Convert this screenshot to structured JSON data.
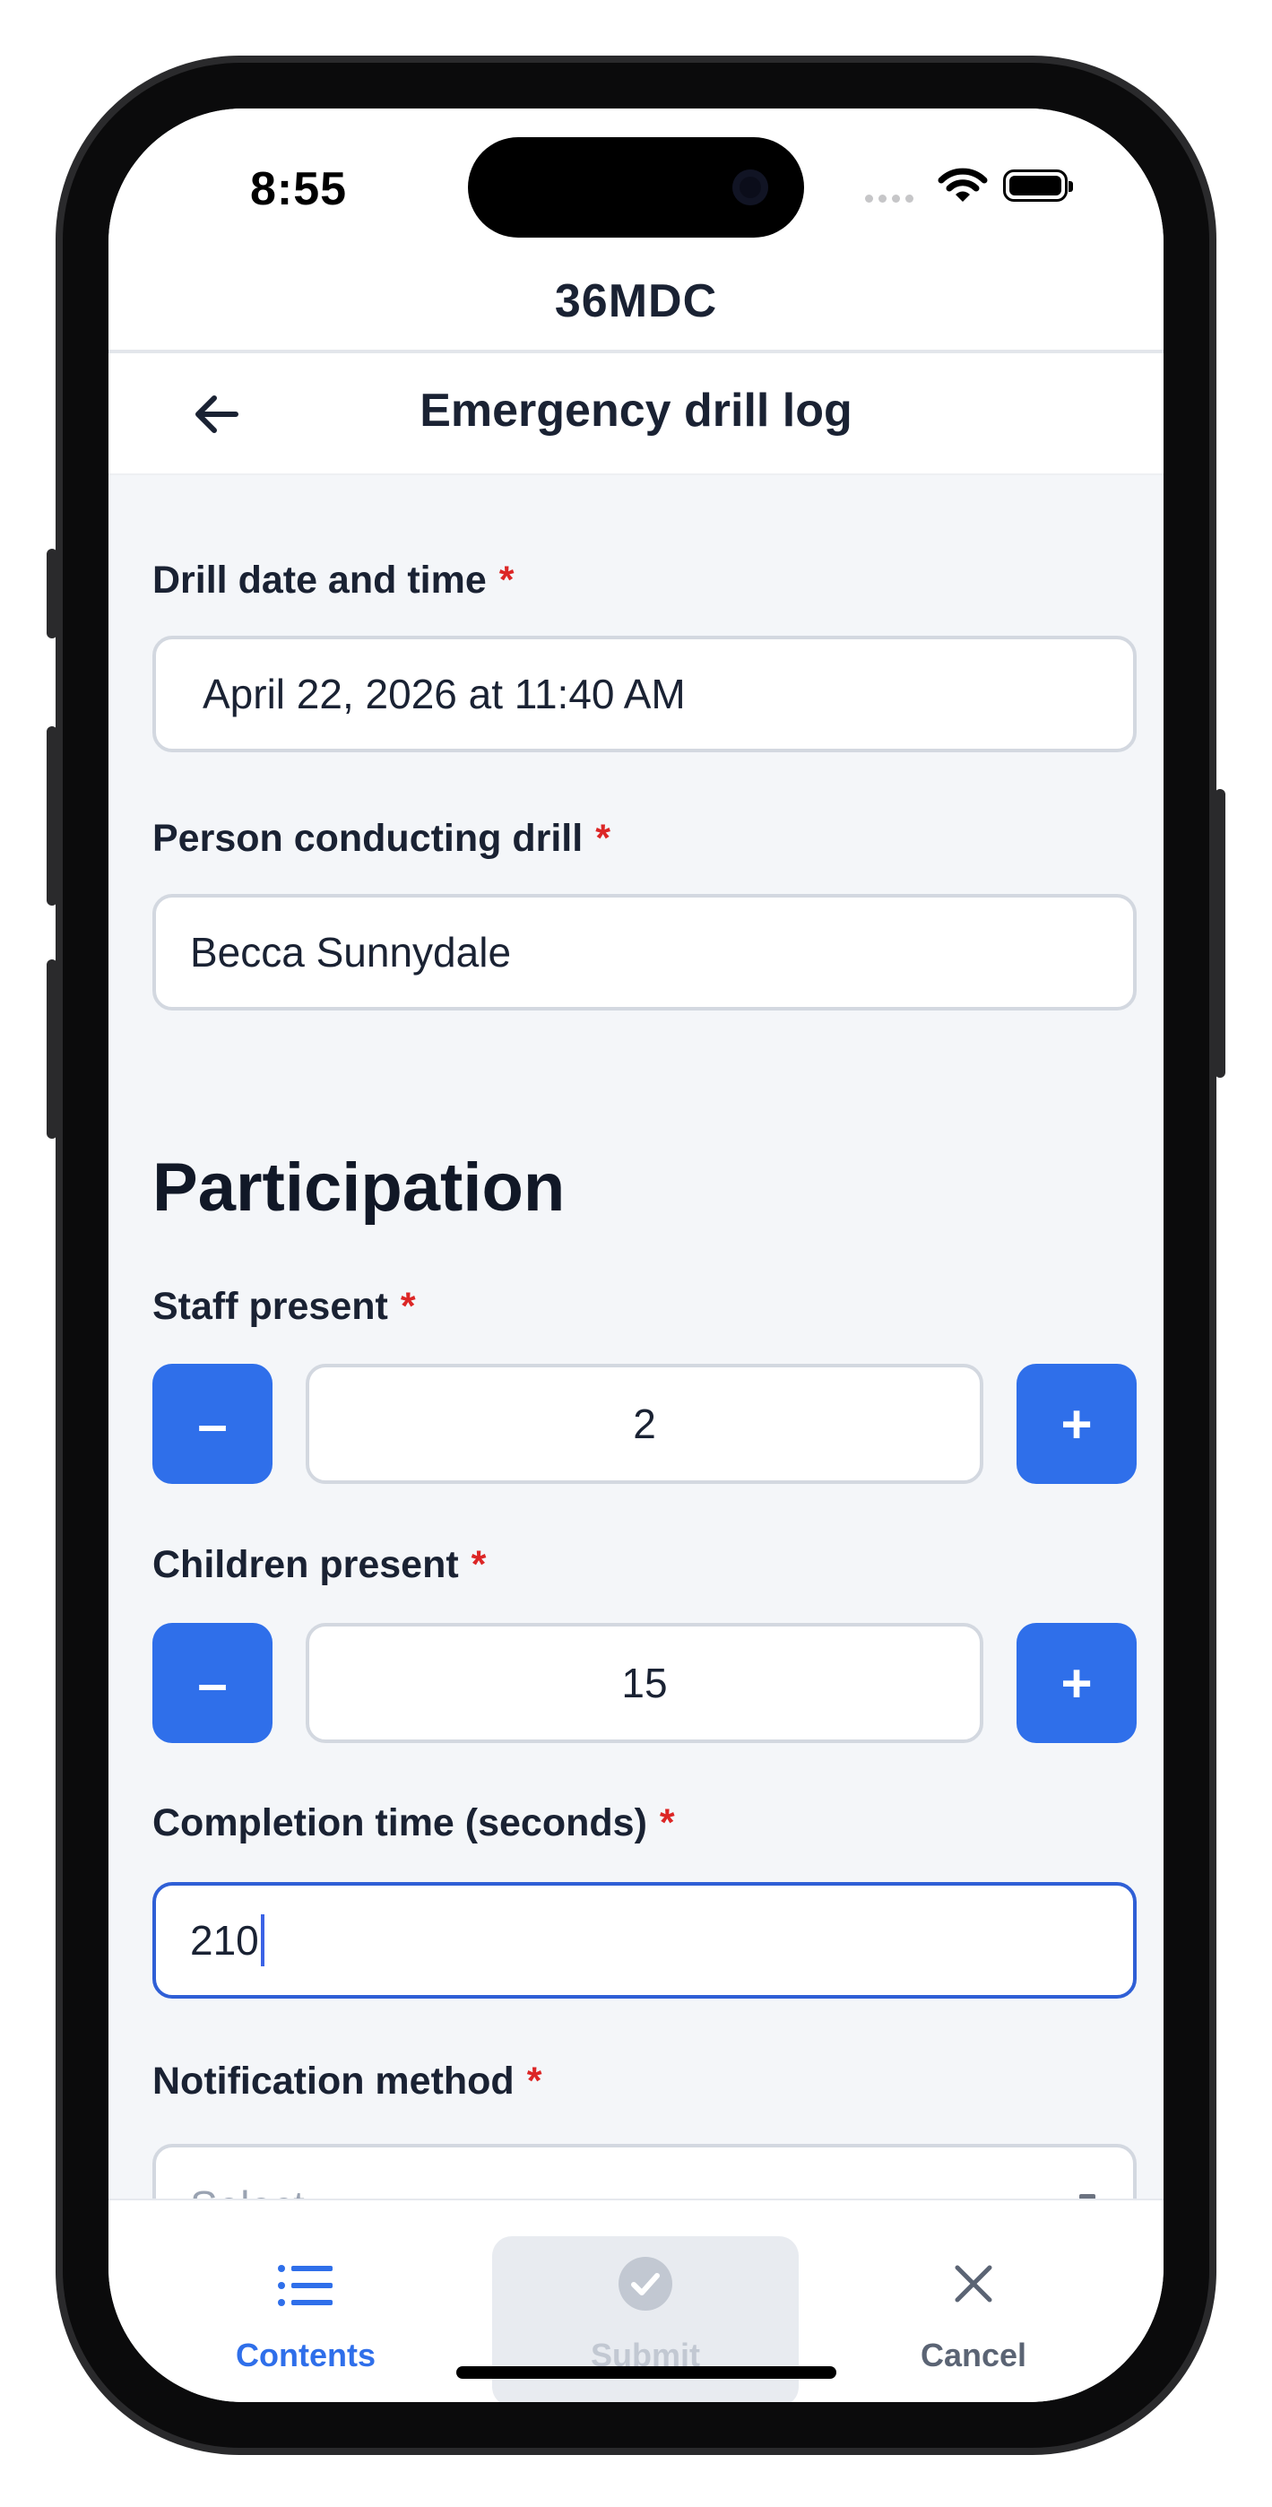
{
  "status_bar": {
    "time": "8:55"
  },
  "app": {
    "title": "36MDC"
  },
  "page": {
    "title": "Emergency drill log"
  },
  "form": {
    "drill_datetime": {
      "label": "Drill date and time",
      "required_mark": "*",
      "value": "April 22, 2026 at 11:40 AM"
    },
    "conductor": {
      "label": "Person conducting drill",
      "required_mark": "*",
      "value": "Becca Sunnydale"
    },
    "section_title": "Participation",
    "staff_present": {
      "label": "Staff present",
      "required_mark": "*",
      "value": "2",
      "minus": "–",
      "plus": "+"
    },
    "children_present": {
      "label": "Children present",
      "required_mark": "*",
      "value": "15",
      "minus": "–",
      "plus": "+"
    },
    "completion_time": {
      "label": "Completion time (seconds)",
      "required_mark": "*",
      "value": "210"
    },
    "notification_method": {
      "label": "Notification method",
      "required_mark": "*",
      "placeholder": "Select"
    }
  },
  "bottom_nav": {
    "contents": {
      "label": "Contents",
      "color": "#2f6fea",
      "icon": "list-icon"
    },
    "submit": {
      "label": "Submit",
      "color": "#c2c8d2",
      "icon": "check-circle-icon"
    },
    "cancel": {
      "label": "Cancel",
      "color": "#5b6474",
      "icon": "close-icon"
    }
  },
  "colors": {
    "accent": "#2f6fea",
    "required": "#dc2626",
    "focus": "#2f5fd6"
  }
}
